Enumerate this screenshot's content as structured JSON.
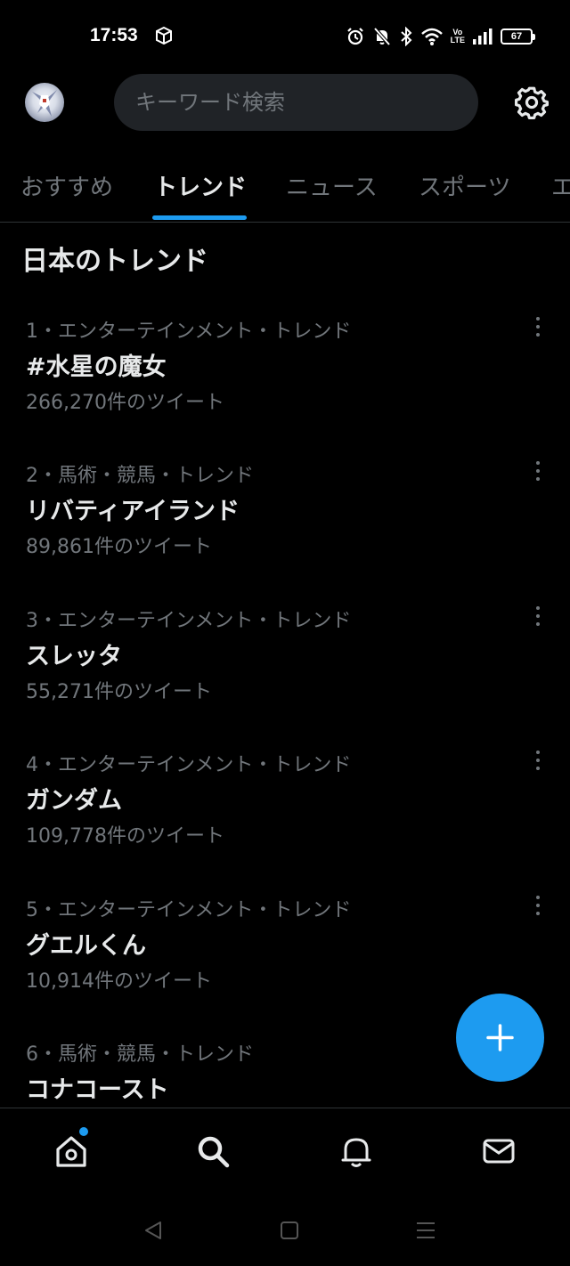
{
  "status_bar": {
    "time": "17:53",
    "battery_level": "67",
    "volte_top": "Vo",
    "volte_bottom": "LTE"
  },
  "header": {
    "search_placeholder": "キーワード検索"
  },
  "tabs": [
    {
      "label": "おすすめ",
      "active": false
    },
    {
      "label": "トレンド",
      "active": true
    },
    {
      "label": "ニュース",
      "active": false
    },
    {
      "label": "スポーツ",
      "active": false
    },
    {
      "label": "エ",
      "active": false
    }
  ],
  "section": {
    "title": "日本のトレンド"
  },
  "trends": [
    {
      "meta": "1・エンターテインメント・トレンド",
      "title": "#水星の魔女",
      "count": "266,270件のツイート"
    },
    {
      "meta": "2・馬術・競馬・トレンド",
      "title": "リバティアイランド",
      "count": "89,861件のツイート"
    },
    {
      "meta": "3・エンターテインメント・トレンド",
      "title": "スレッタ",
      "count": "55,271件のツイート"
    },
    {
      "meta": "4・エンターテインメント・トレンド",
      "title": "ガンダム",
      "count": "109,778件のツイート"
    },
    {
      "meta": "5・エンターテインメント・トレンド",
      "title": "グエルくん",
      "count": "10,914件のツイート"
    },
    {
      "meta": "6・馬術・競馬・トレンド",
      "title": "コナコースト",
      "count": ""
    }
  ],
  "icons": {
    "accent_color": "#1d9bf0",
    "fab": "plus-icon",
    "nav": [
      "home-icon",
      "search-icon",
      "bell-icon",
      "mail-icon"
    ]
  }
}
